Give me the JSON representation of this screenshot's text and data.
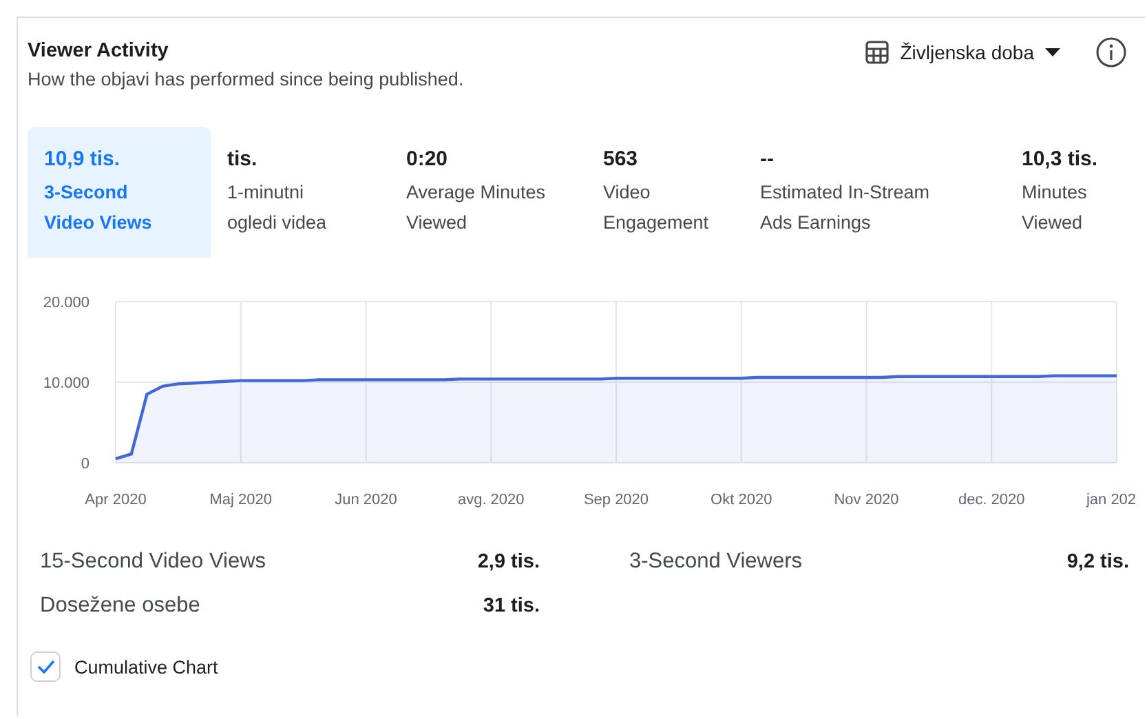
{
  "header": {
    "title": "Viewer Activity",
    "subtitle": "How the objavi has performed since being published.",
    "range": "Življenska doba"
  },
  "metrics": [
    {
      "value": "10,9 tis.",
      "label": "3-Second Video Views",
      "selected": true
    },
    {
      "value": "tis.",
      "label": "1-minutni ogledi videa",
      "selected": false
    },
    {
      "value": "0:20",
      "label": "Average Minutes Viewed",
      "selected": false
    },
    {
      "value": "563",
      "label": "Video Engagement",
      "selected": false
    },
    {
      "value": "--",
      "label": "Estimated In-Stream Ads Earnings",
      "selected": false
    },
    {
      "value": "10,3 tis.",
      "label": "Minutes Viewed",
      "selected": false
    }
  ],
  "chart_data": {
    "type": "area",
    "categories": [
      "Apr 2020",
      null,
      null,
      null,
      null,
      null,
      null,
      null,
      "Maj 2020",
      null,
      null,
      null,
      null,
      null,
      null,
      null,
      "Jun 2020",
      null,
      null,
      null,
      null,
      null,
      null,
      null,
      "avg. 2020",
      null,
      null,
      null,
      null,
      null,
      null,
      null,
      "Sep 2020",
      null,
      null,
      null,
      null,
      null,
      null,
      null,
      "Okt 2020",
      null,
      null,
      null,
      null,
      null,
      null,
      null,
      "Nov 2020",
      null,
      null,
      null,
      null,
      null,
      null,
      null,
      "dec. 2020",
      null,
      null,
      null,
      null,
      null,
      null,
      null,
      "jan 202"
    ],
    "grid": true,
    "series": [
      {
        "color": "#4267d6",
        "values": [
          500,
          1100,
          8500,
          9500,
          9800,
          9900,
          10000,
          10100,
          10200,
          10200,
          10200,
          10200,
          10200,
          10300,
          10300,
          10300,
          10300,
          10300,
          10300,
          10300,
          10300,
          10300,
          10400,
          10400,
          10400,
          10400,
          10400,
          10400,
          10400,
          10400,
          10400,
          10400,
          10500,
          10500,
          10500,
          10500,
          10500,
          10500,
          10500,
          10500,
          10500,
          10600,
          10600,
          10600,
          10600,
          10600,
          10600,
          10600,
          10600,
          10600,
          10700,
          10700,
          10700,
          10700,
          10700,
          10700,
          10700,
          10700,
          10700,
          10700,
          10800,
          10800,
          10800,
          10800,
          10800
        ]
      }
    ],
    "yticks": [
      {
        "value": 0,
        "label": "0"
      },
      {
        "value": 10000,
        "label": "10.000"
      },
      {
        "value": 20000,
        "label": "20.000"
      }
    ],
    "ylim": [
      0,
      20000
    ]
  },
  "stats": [
    {
      "label": "15-Second Video Views",
      "value": "2,9 tis."
    },
    {
      "label": "3-Second Viewers",
      "value": "9,2 tis."
    },
    {
      "label": "Dosežene osebe",
      "value": "31 tis."
    }
  ],
  "cumulative": {
    "label": "Cumulative Chart",
    "checked": true
  }
}
